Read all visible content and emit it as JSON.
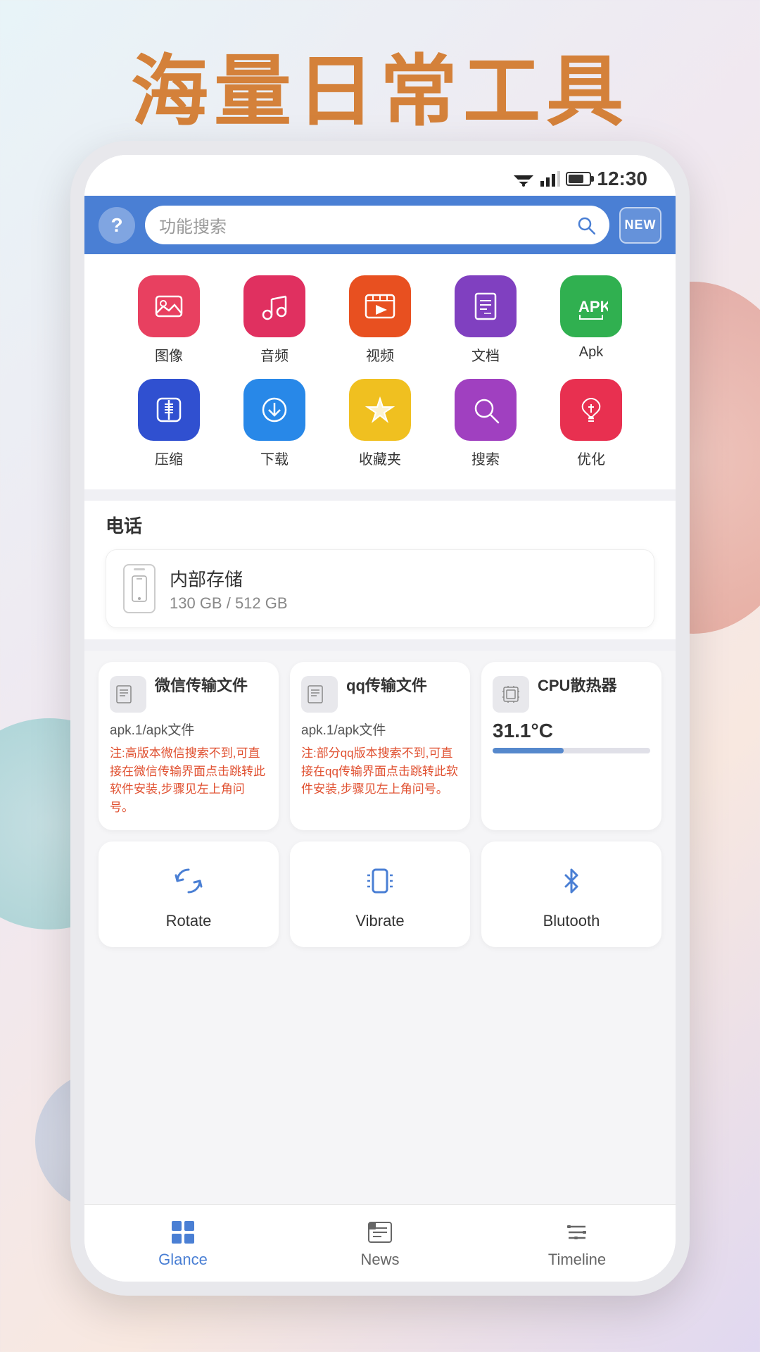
{
  "page": {
    "title": "海量日常工具",
    "title_color": "#d4813a"
  },
  "status_bar": {
    "time": "12:30"
  },
  "header": {
    "search_placeholder": "功能搜索",
    "new_badge": "NEW",
    "help_symbol": "?"
  },
  "app_grid": {
    "row1": [
      {
        "label": "图像",
        "color": "#e84060",
        "icon": "🖼️"
      },
      {
        "label": "音频",
        "color": "#e03060",
        "icon": "🎵"
      },
      {
        "label": "视频",
        "color": "#e85020",
        "icon": "▶️"
      },
      {
        "label": "文档",
        "color": "#8040c0",
        "icon": "📄"
      },
      {
        "label": "Apk",
        "color": "#30b050",
        "icon": "📦"
      }
    ],
    "row2": [
      {
        "label": "压缩",
        "color": "#3050d0",
        "icon": "🗜️"
      },
      {
        "label": "下载",
        "color": "#2888e8",
        "icon": "⬇️"
      },
      {
        "label": "收藏夹",
        "color": "#f0c020",
        "icon": "⭐"
      },
      {
        "label": "搜索",
        "color": "#a040c0",
        "icon": "🔍"
      },
      {
        "label": "优化",
        "color": "#e83050",
        "icon": "🚀"
      }
    ]
  },
  "phone_section": {
    "title": "电话",
    "storage": {
      "name": "内部存储",
      "used": "130 GB",
      "total": "512 GB",
      "display": "130 GB / 512 GB"
    }
  },
  "tool_cards": [
    {
      "title": "微信传输文件",
      "subtitle": "apk.1/apk文件",
      "note": "注:高版本微信搜索不到,可直接在微信传输界面点击跳转此软件安装,步骤见左上角问号。"
    },
    {
      "title": "qq传输文件",
      "subtitle": "apk.1/apk文件",
      "note": "注:部分qq版本搜索不到,可直接在qq传输界面点击跳转此软件安装,步骤见左上角问号。"
    },
    {
      "title": "CPU散热器",
      "temp": "31.1°C",
      "bar_percent": 45
    }
  ],
  "quick_actions": [
    {
      "label": "Rotate",
      "icon": "rotate"
    },
    {
      "label": "Vibrate",
      "icon": "vibrate"
    },
    {
      "label": "Blutooth",
      "icon": "bluetooth"
    }
  ],
  "bottom_nav": {
    "items": [
      {
        "label": "Glance",
        "icon": "grid",
        "active": true
      },
      {
        "label": "News",
        "icon": "news",
        "active": false
      },
      {
        "label": "Timeline",
        "icon": "timeline",
        "active": false
      }
    ]
  }
}
